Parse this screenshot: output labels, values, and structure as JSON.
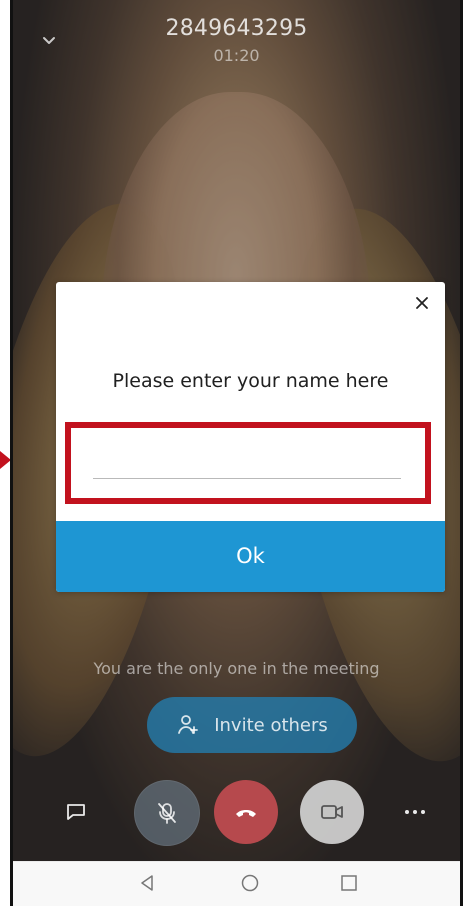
{
  "call": {
    "caller_number": "2849643295",
    "duration": "01:20"
  },
  "dialog": {
    "title": "Please enter your name here",
    "input_value": "",
    "input_placeholder": "",
    "ok_label": "Ok",
    "close_icon": "close-icon"
  },
  "meeting": {
    "status_text": "You are the only one in the meeting",
    "invite_label": "Invite others",
    "invite_icon": "add-person-icon"
  },
  "controls": {
    "chat_icon": "chat-icon",
    "mic_icon": "mic-off-icon",
    "hangup_icon": "phone-hangup-icon",
    "video_icon": "video-camera-icon",
    "more_icon": "more-options-icon"
  },
  "system_nav": {
    "back_icon": "back-triangle-icon",
    "home_icon": "home-circle-icon",
    "recent_icon": "recent-apps-square-icon"
  },
  "colors": {
    "primary_blue": "#1e96d3",
    "highlight_red": "#c2121e",
    "hangup_red": "#b6494d",
    "white": "#ffffff"
  }
}
